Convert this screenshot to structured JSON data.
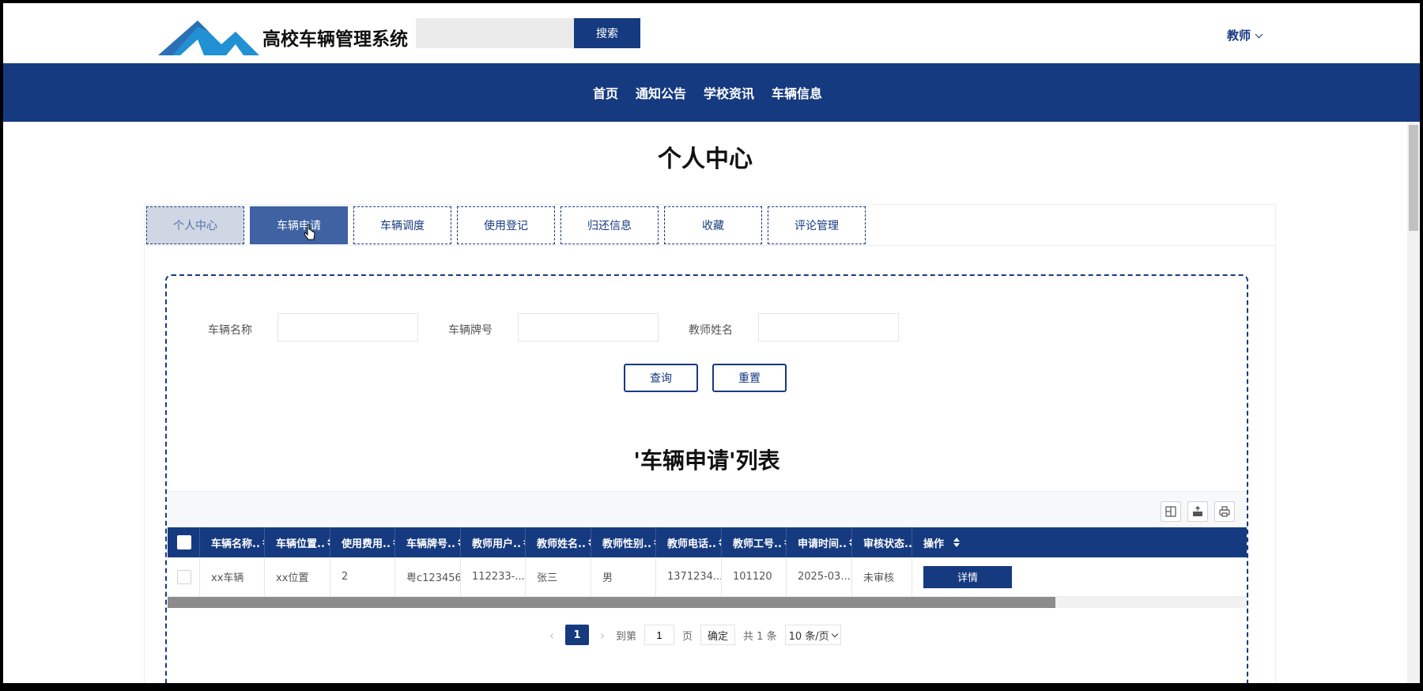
{
  "header": {
    "site_title": "高校车辆管理系统",
    "search_placeholder": "",
    "search_button": "搜索",
    "user_menu": "教师"
  },
  "nav": {
    "items": [
      "首页",
      "通知公告",
      "学校资讯",
      "车辆信息"
    ]
  },
  "page_title": "个人中心",
  "tabs": [
    {
      "label": "个人中心",
      "state": "inactive-shaded"
    },
    {
      "label": "车辆申请",
      "state": "active"
    },
    {
      "label": "车辆调度",
      "state": "normal"
    },
    {
      "label": "使用登记",
      "state": "normal"
    },
    {
      "label": "归还信息",
      "state": "normal"
    },
    {
      "label": "收藏",
      "state": "normal"
    },
    {
      "label": "评论管理",
      "state": "normal"
    }
  ],
  "search_form": {
    "vehicle_name_label": "车辆名称",
    "plate_label": "车辆牌号",
    "teacher_name_label": "教师姓名",
    "vehicle_name_value": "",
    "plate_value": "",
    "teacher_name_value": "",
    "query_button": "查询",
    "reset_button": "重置"
  },
  "list_title": "'车辆申请'列表",
  "toolbar_icons": [
    "columns-icon",
    "export-icon",
    "print-icon"
  ],
  "table": {
    "columns": [
      "车辆名称..",
      "车辆位置..",
      "使用费用..",
      "车辆牌号..",
      "教师用户..",
      "教师姓名..",
      "教师性别..",
      "教师电话..",
      "教师工号..",
      "申请时间..",
      "审核状态..",
      "操作"
    ],
    "rows": [
      {
        "cells": [
          "xx车辆",
          "xx位置",
          "2",
          "粤c123456",
          "112233-...",
          "张三",
          "男",
          "1371234...",
          "101120",
          "2025-03...",
          "未审核"
        ],
        "action": "详情"
      }
    ]
  },
  "pagination": {
    "current_page": "1",
    "goto_label": "到第",
    "goto_value": "1",
    "page_unit": "页",
    "confirm": "确定",
    "total": "共 1 条",
    "page_size": "10 条/页"
  },
  "colors": {
    "primary": "#163a80",
    "active_tab": "#3e62a2"
  }
}
